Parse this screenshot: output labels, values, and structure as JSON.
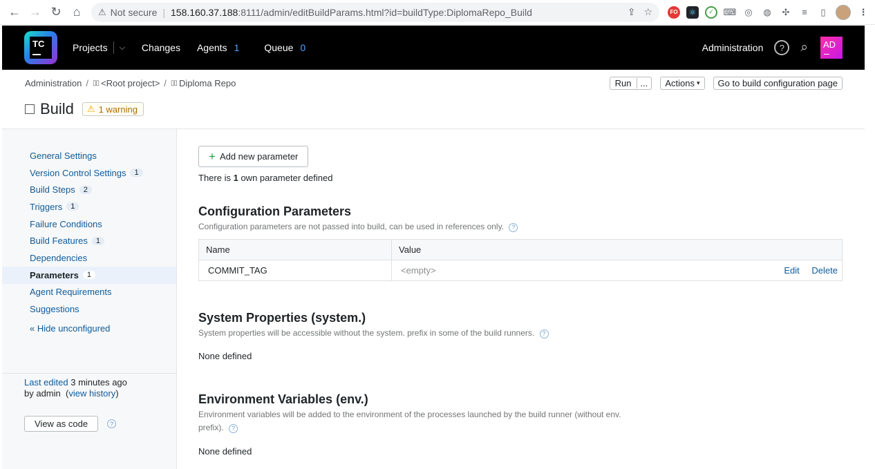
{
  "browser": {
    "security_label": "Not secure",
    "url_host": "158.160.37.188",
    "url_path": ":8111/admin/editBuildParams.html?id=buildType:DiplomaRepo_Build",
    "ext_fo": "FO"
  },
  "header": {
    "logo_text": "TC",
    "nav": {
      "projects": "Projects",
      "changes": "Changes",
      "agents": "Agents",
      "agents_count": "1",
      "queue": "Queue",
      "queue_count": "0"
    },
    "administration": "Administration",
    "avatar_initials": "AD"
  },
  "breadcrumb": {
    "root": "Administration",
    "root_project": "<Root project>",
    "project": "Diploma Repo"
  },
  "actions": {
    "run": "Run",
    "run_more": "...",
    "actions": "Actions",
    "go_to_build": "Go to build configuration page"
  },
  "page": {
    "title": "Build",
    "warning": "1 warning"
  },
  "sidebar": {
    "items": [
      {
        "label": "General Settings",
        "badge": ""
      },
      {
        "label": "Version Control Settings",
        "badge": "1"
      },
      {
        "label": "Build Steps",
        "badge": "2"
      },
      {
        "label": "Triggers",
        "badge": "1"
      },
      {
        "label": "Failure Conditions",
        "badge": ""
      },
      {
        "label": "Build Features",
        "badge": "1"
      },
      {
        "label": "Dependencies",
        "badge": ""
      },
      {
        "label": "Parameters",
        "badge": "1"
      },
      {
        "label": "Agent Requirements",
        "badge": ""
      },
      {
        "label": "Suggestions",
        "badge": ""
      }
    ],
    "hide_unconfigured": "« Hide unconfigured",
    "last_edited_label": "Last edited",
    "last_edited_time": "3 minutes ago",
    "by_label": "by admin",
    "view_history": "view history",
    "view_as_code": "View as code"
  },
  "main": {
    "add_parameter": "Add new parameter",
    "own_params_prefix": "There is",
    "own_params_count": "1",
    "own_params_suffix": "own parameter defined",
    "config": {
      "title": "Configuration Parameters",
      "desc": "Configuration parameters are not passed into build, can be used in references only.",
      "col_name": "Name",
      "col_value": "Value",
      "rows": [
        {
          "name": "COMMIT_TAG",
          "value": "<empty>",
          "edit": "Edit",
          "delete": "Delete"
        }
      ]
    },
    "system": {
      "title": "System Properties (system.)",
      "desc": "System properties will be accessible without the system. prefix in some of the build runners.",
      "none": "None defined"
    },
    "env": {
      "title": "Environment Variables (env.)",
      "desc_line1": "Environment variables will be added to the environment of the processes launched by the build runner (without env.",
      "desc_line2": "prefix).",
      "none": "None defined"
    }
  }
}
